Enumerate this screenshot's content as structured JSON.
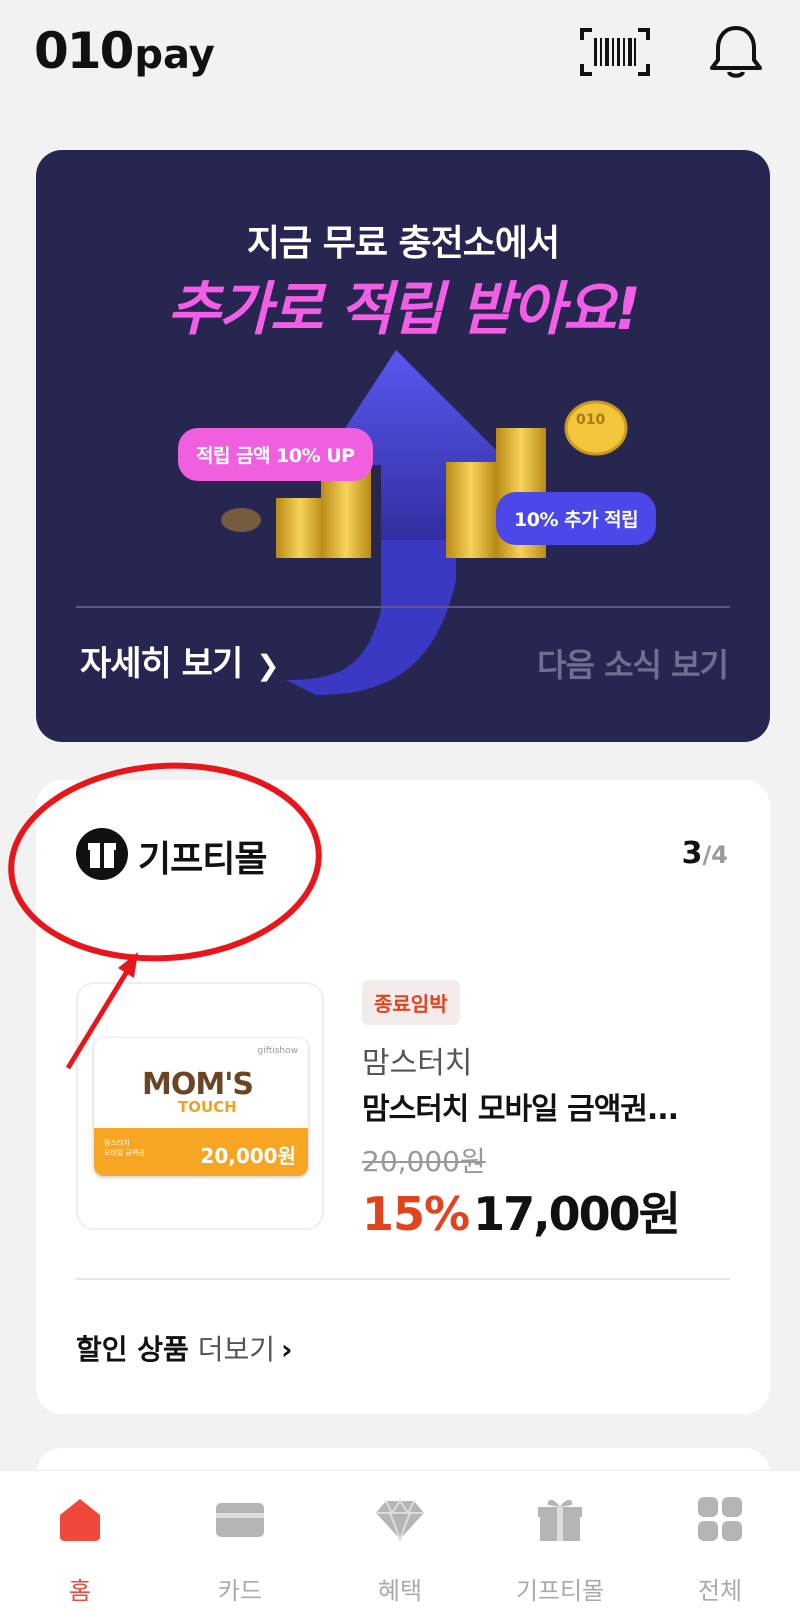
{
  "header": {
    "logo_main": "010",
    "logo_sub": "pay",
    "barcode_icon": "barcode-scanner-icon",
    "bell_icon": "bell-icon"
  },
  "banner": {
    "line1": "지금 무료 충전소에서",
    "line2": "추가로 적립 받아요!",
    "bubble_left": "적립 금액 10% UP",
    "bubble_right": "10% 추가 적립",
    "coin_text": "010",
    "more_label": "자세히 보기",
    "next_label": "다음 소식 보기",
    "colors": {
      "background": "#272650",
      "accent_pink": "#f25fe6",
      "accent_blue": "#4b47e8"
    }
  },
  "gift": {
    "title": "기프티몰",
    "pager_current": "3",
    "pager_total": "/4",
    "voucher": {
      "top_text": "giftishow",
      "brand_line1": "MOM'S",
      "brand_line2": "TOUCH",
      "band_small_1": "맘스터치",
      "band_small_2": "모바일 금액권",
      "band_amount": "20,000원"
    },
    "badge": "종료임박",
    "brand_name": "맘스터치",
    "product_name": "맘스터치 모바일 금액권...",
    "original_price": "20,000원",
    "discount": "15%",
    "final_price": "17,000원",
    "more_bold": "할인 상품",
    "more_light": " 더보기",
    "more_chevron": "›"
  },
  "bottom_nav": [
    {
      "label": "홈",
      "icon": "home-icon",
      "active": true
    },
    {
      "label": "카드",
      "icon": "card-icon",
      "active": false
    },
    {
      "label": "혜택",
      "icon": "diamond-icon",
      "active": false
    },
    {
      "label": "기프티몰",
      "icon": "gift-icon",
      "active": false
    },
    {
      "label": "전체",
      "icon": "grid-icon",
      "active": false
    }
  ]
}
